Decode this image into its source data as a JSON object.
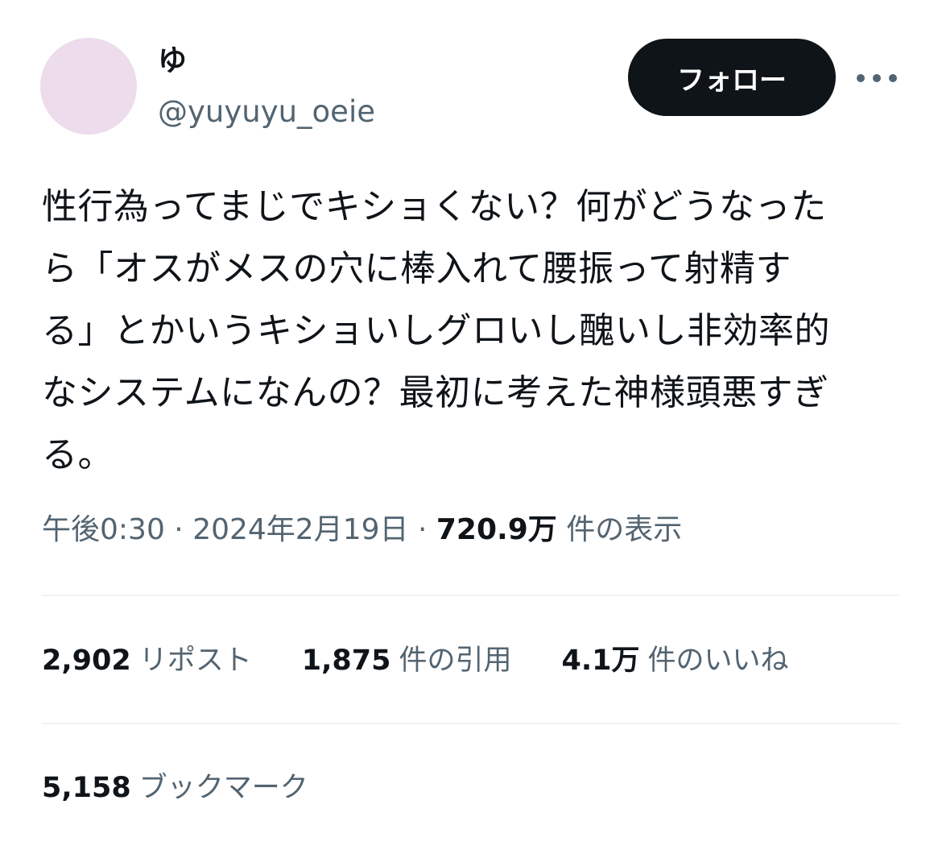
{
  "user": {
    "display_name": "ゆ",
    "handle": "@yuyuyu_oeie"
  },
  "header": {
    "follow_label": "フォロー",
    "more_icon": "more-horizontal-icon"
  },
  "tweet": {
    "text": "性行為ってまじでキショくない？何がどうなった\nら「オスがメスの穴に棒入れて腰振って射精す\nる」とかいうキショいしグロいし醜いし非効率的\nなシステムになんの？最初に考えた神様頭悪すぎ\nる。",
    "time": "午後0:30",
    "date": "2024年2月19日",
    "separator": " · ",
    "views_count": "720.9万",
    "views_label": "件の表示"
  },
  "stats": {
    "reposts": {
      "count": "2,902",
      "label": "リポスト"
    },
    "quotes": {
      "count": "1,875",
      "label": "件の引用"
    },
    "likes": {
      "count": "4.1万",
      "label": "件のいいね"
    },
    "bookmarks": {
      "count": "5,158",
      "label": "ブックマーク"
    }
  },
  "colors": {
    "text_primary": "#0f1419",
    "text_secondary": "#536471",
    "divider": "#eff3f4",
    "avatar_bg": "#ecdcec",
    "button_bg": "#0f1419"
  }
}
